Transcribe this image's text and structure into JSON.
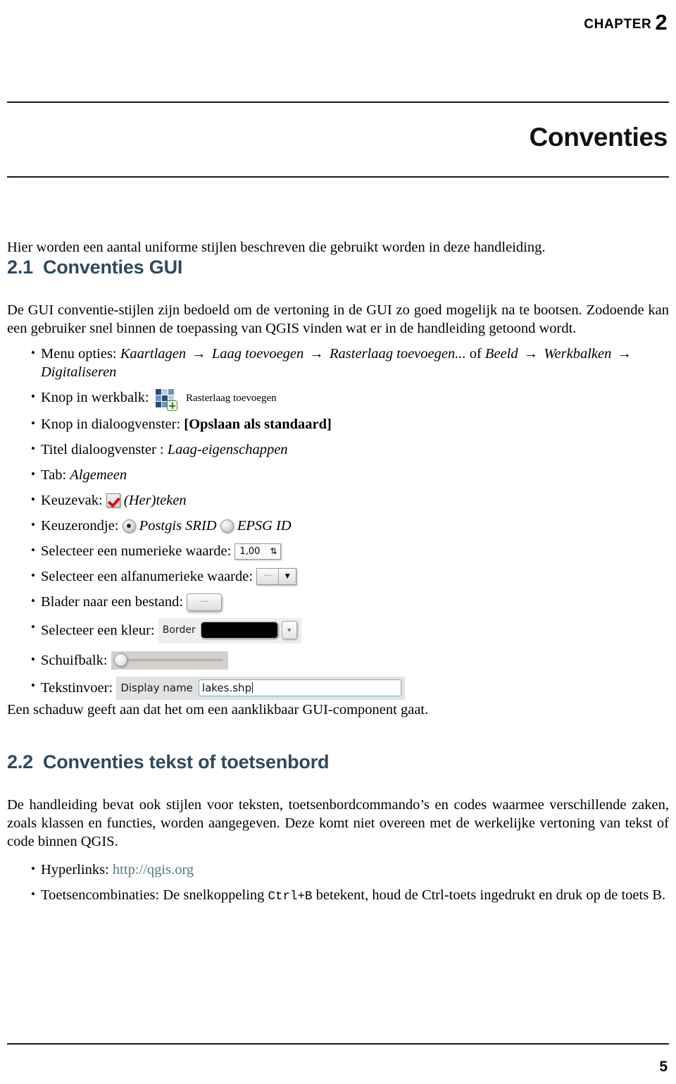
{
  "header": {
    "chapter_word": "CHAPTER",
    "chapter_number": "2",
    "chapter_title": "Conventies"
  },
  "intro": "Hier worden een aantal uniforme stijlen beschreven die gebruikt worden in deze handleiding.",
  "sections": [
    {
      "number": "2.1",
      "title": "Conventies GUI",
      "paragraph": "De GUI conventie-stijlen zijn bedoeld om de vertoning in de GUI zo goed mogelijk na te bootsen. Zodoende kan een gebruiker snel binnen de toepassing van QGIS vinden wat er in de handleiding getoond wordt."
    },
    {
      "number": "2.2",
      "title": "Conventies tekst of toetsenbord",
      "paragraph": "De handleiding bevat ook stijlen voor teksten, toetsenbordcommando’s en codes waarmee verschillende zaken, zoals klassen en functies, worden aangegeven. Deze komt niet overeen met de werkelijke vertoning van tekst of code binnen QGIS."
    }
  ],
  "gui_bullets": {
    "menu": {
      "label": "Menu opties:",
      "path1": [
        "Kaartlagen",
        "Laag toevoegen",
        "Rasterlaag toevoegen..."
      ],
      "conjunction": "of",
      "path2": [
        "Beeld",
        "Werkbalken",
        "Digitaliseren"
      ],
      "arrow": "→"
    },
    "toolbar": {
      "label": "Knop in werkbalk:",
      "button_label": "Rasterlaag toevoegen",
      "icon": "raster-layer-add-icon"
    },
    "dialog_button": {
      "label": "Knop in dialoogvenster:",
      "value": "[Opslaan als standaard]"
    },
    "dialog_title": {
      "label": "Titel dialoogvenster :",
      "value": "Laag-eigenschappen"
    },
    "tab": {
      "label": "Tab:",
      "value": "Algemeen"
    },
    "checkbox": {
      "label": "Keuzevak:",
      "value": "(Her)teken",
      "checked": true
    },
    "radio": {
      "label": "Keuzerondje:",
      "option_selected": "Postgis SRID",
      "option_unselected": "EPSG ID"
    },
    "spinbox": {
      "label": "Selecteer een numerieke waarde:",
      "value": "1,00",
      "arrows": "⇅"
    },
    "combobox": {
      "label": "Selecteer een alfanumerieke waarde:",
      "dots": "···",
      "caret": "▼"
    },
    "browse": {
      "label": "Blader naar een bestand:",
      "button_text": "···"
    },
    "color": {
      "label": "Selecteer een kleur:",
      "widget_label": "Border",
      "swatch_color": "#000000",
      "caret": "▼"
    },
    "slider": {
      "label": "Schuifbalk:"
    },
    "textinput": {
      "label": "Tekstinvoer:",
      "widget_label": "Display name",
      "value": "lakes.shp"
    }
  },
  "shadow_note": "Een schaduw geeft aan dat het om een aanklikbaar GUI-component gaat.",
  "text_bullets": {
    "hyperlink": {
      "label": "Hyperlinks:",
      "url": "http://qgis.org"
    },
    "shortcut": {
      "label": "Toetsencombinaties:",
      "text_before": "De snelkoppeling",
      "keys": "Ctrl+B",
      "text_after": "betekent, houd de Ctrl-toets ingedrukt en druk op de toets B."
    }
  },
  "footer": {
    "page_number": "5"
  },
  "colors": {
    "heading": "#2c4a5e",
    "link": "#4d7c85",
    "check": "#cc1111"
  }
}
